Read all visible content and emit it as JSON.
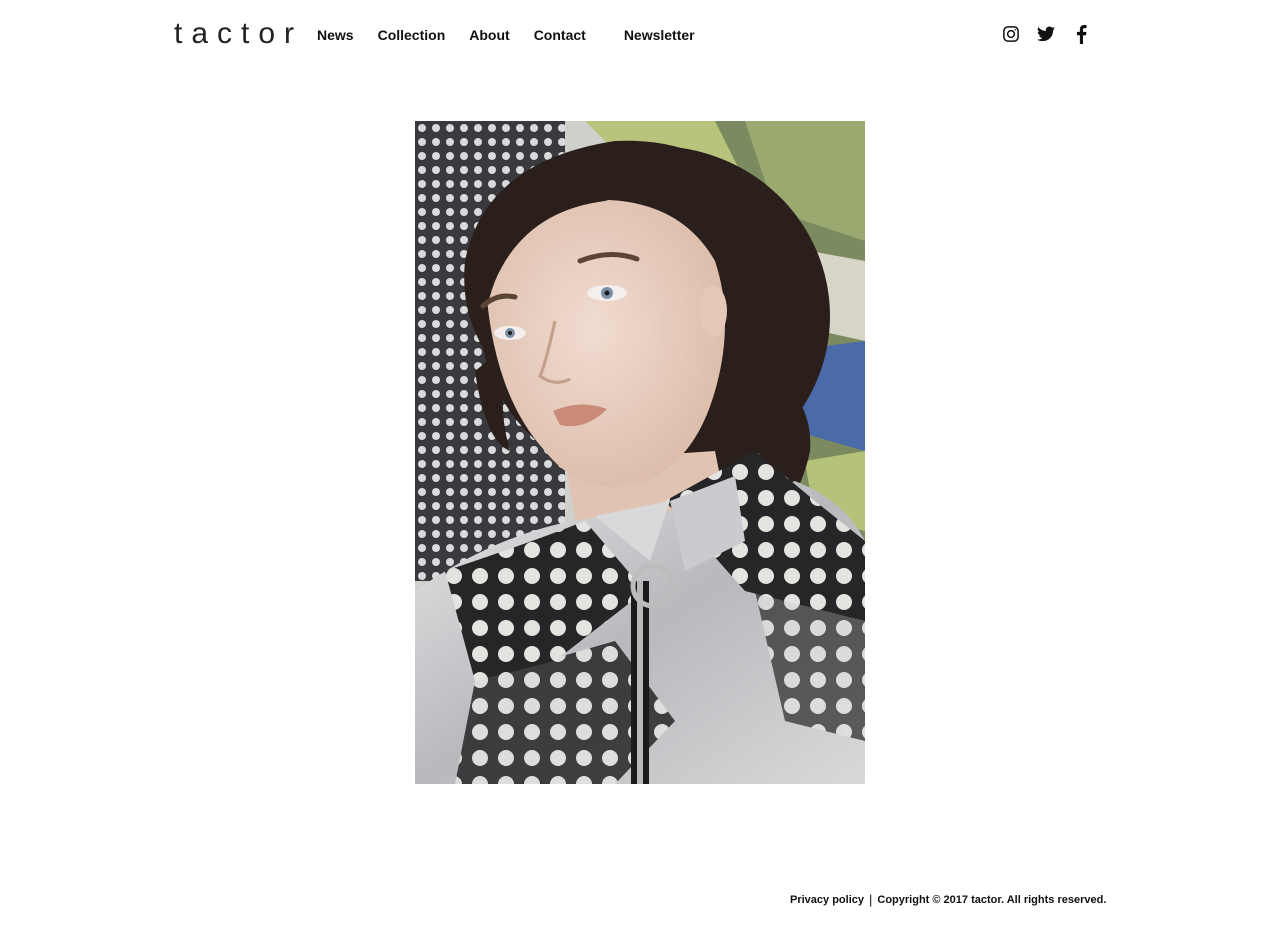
{
  "brand": {
    "logo_text": "tactor"
  },
  "nav": {
    "items": [
      {
        "label": "News"
      },
      {
        "label": "Collection"
      },
      {
        "label": "About"
      },
      {
        "label": "Contact"
      },
      {
        "label": "Newsletter"
      }
    ]
  },
  "social": {
    "icons": [
      "instagram-icon",
      "twitter-icon",
      "facebook-icon"
    ]
  },
  "hero": {
    "image": "portrait of model with dark curly hair wearing silver metallic polka-dot zip shirt against patterned backdrop",
    "colors": {
      "background_blue": "#4a6aa8",
      "background_leaf": "#b5c27a",
      "skin": "#ead0c2",
      "hair": "#2a1f1a",
      "shirt_silver": "#cfd1d3",
      "shirt_dark": "#2b2b2e"
    }
  },
  "footer": {
    "privacy_label": "Privacy policy",
    "separator": "|",
    "copyright": "Copyright © 2017 tactor. All rights reserved."
  }
}
